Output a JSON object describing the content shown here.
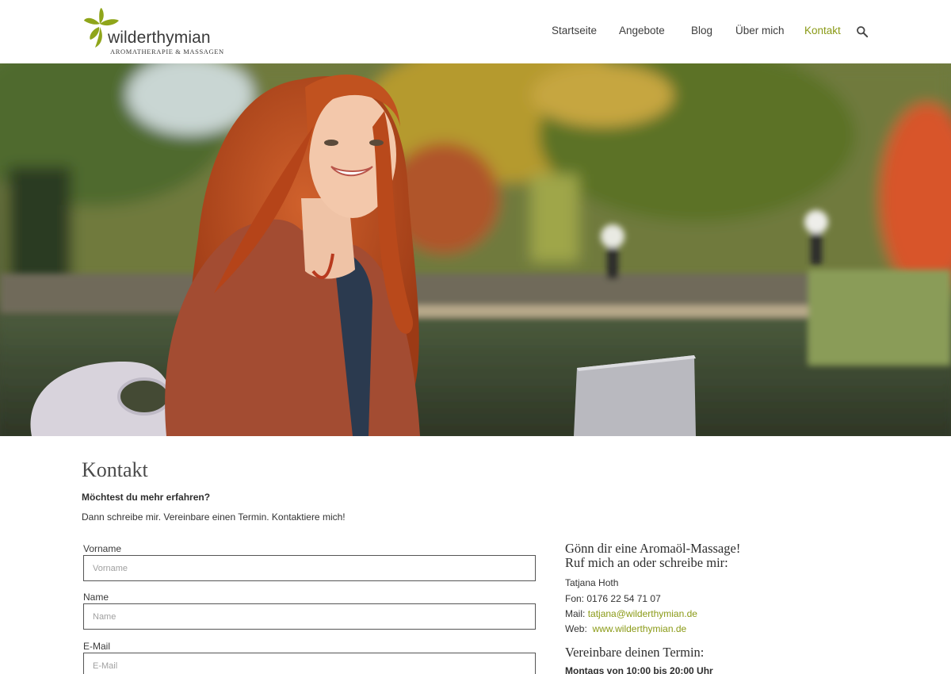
{
  "header": {
    "logo": {
      "brand": "wilderthymian",
      "tagline": "AROMATHERAPIE & MASSAGEN"
    },
    "nav": [
      {
        "label": "Startseite",
        "active": false
      },
      {
        "label": "Angebote",
        "active": false
      },
      {
        "label": "Blog",
        "active": false
      },
      {
        "label": "Über mich",
        "active": false
      },
      {
        "label": "Kontakt",
        "active": true
      }
    ],
    "search_icon": "search-icon",
    "colors": {
      "accent": "#8a9a16",
      "logo_leaf": "#8fa51a"
    }
  },
  "page": {
    "title": "Kontakt",
    "intro_heading": "Möchtest du mehr erfahren?",
    "intro_text": "Dann schreibe mir. Vereinbare einen Termin. Kontaktiere mich!"
  },
  "form": {
    "fields": [
      {
        "label": "Vorname",
        "placeholder": "Vorname"
      },
      {
        "label": "Name",
        "placeholder": "Name"
      },
      {
        "label": "E-Mail",
        "placeholder": "E-Mail"
      }
    ]
  },
  "sidebar": {
    "heading_line1": "Gönn dir eine Aromaöl-Massage!",
    "heading_line2": "Ruf mich an oder schreibe mir:",
    "contact_name": "Tatjana Hoth",
    "phone_label": "Fon:",
    "phone": "0176 22 54 71 07",
    "mail_label": "Mail:",
    "email": "tatjana@wilderthymian.de",
    "web_label": "Web:",
    "website": "www.wilderthymian.de",
    "appointment_heading": "Vereinbare deinen Termin:",
    "opening_hours": "Montags von 10:00 bis 20:00 Uhr"
  }
}
